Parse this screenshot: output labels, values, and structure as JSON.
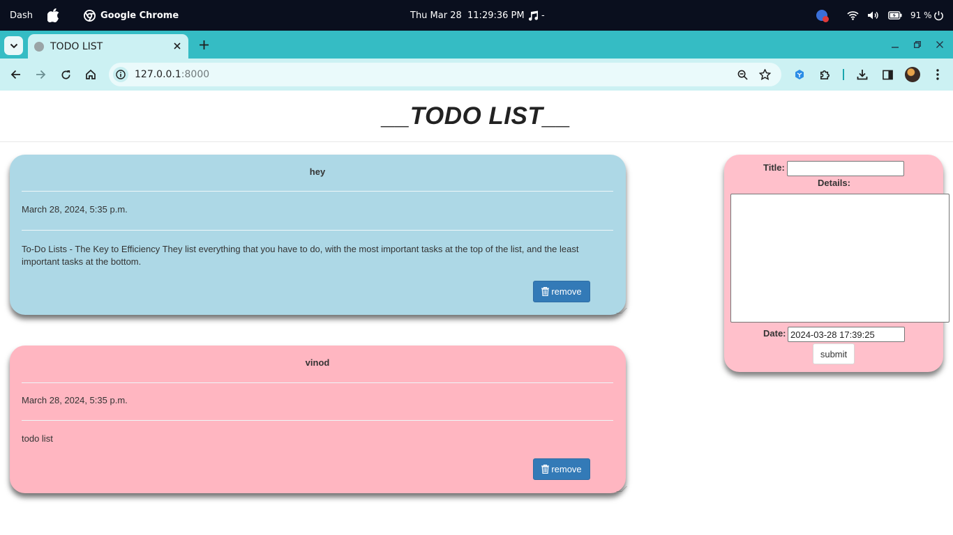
{
  "os_bar": {
    "dash_label": "Dash",
    "app_name": "Google Chrome",
    "clock": "Thu Mar 28  11:29:36 PM",
    "music_label": "-",
    "battery": "91 %"
  },
  "browser": {
    "tab_title": "TODO LIST",
    "url_host": "127.0.0.1",
    "url_port": ":8000",
    "accent_color": "#35bcc4"
  },
  "page": {
    "title": "__TODO LIST__"
  },
  "todos": [
    {
      "title": "hey",
      "date": "March 28, 2024, 5:35 p.m.",
      "body": "To-Do Lists - The Key to Efficiency They list everything that you have to do, with the most important tasks at the top of the list, and the least important tasks at the bottom.",
      "remove_label": "remove",
      "color": "#add8e6"
    },
    {
      "title": "vinod",
      "date": "March 28, 2024, 5:35 p.m.",
      "body": "todo list",
      "remove_label": "remove",
      "color": "#ffb6c1"
    }
  ],
  "form": {
    "title_label": "Title:",
    "title_value": "",
    "details_label": "Details:",
    "details_value": "",
    "date_label": "Date:",
    "date_value": "2024-03-28 17:39:25",
    "submit_label": "submit",
    "color": "#ffc0cb"
  }
}
